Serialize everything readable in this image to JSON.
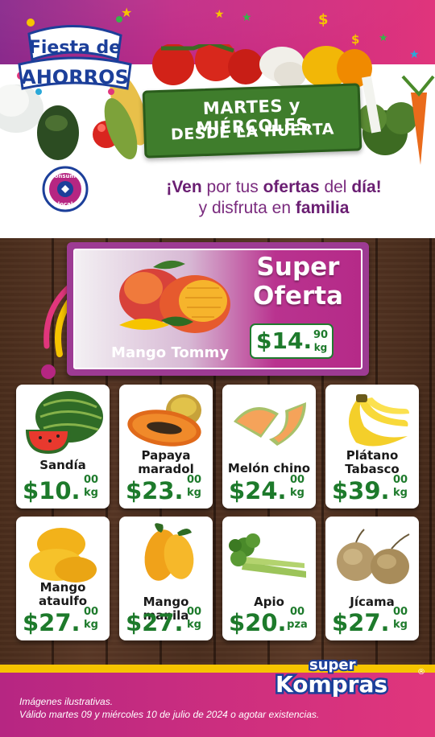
{
  "header": {
    "logo_line1": "Fiesta de",
    "logo_line2": "AHORROS",
    "banner_line1": "MARTES y MIÉRCOLES",
    "banner_line2": "DESDE LA HUERTA",
    "consume_local_line1": "consume",
    "consume_local_line2": "local",
    "tagline": {
      "l1_a": "¡Ven",
      "l1_b": " por tus ",
      "l1_c": "ofertas",
      "l1_d": " del ",
      "l1_e": "día!",
      "l2_a": "y disfruta en ",
      "l2_b": "familia"
    }
  },
  "feature": {
    "badge_line1": "Super",
    "badge_line2": "Oferta",
    "name": "Mango Tommy",
    "price_main": "$14.",
    "price_cents": "90",
    "unit": "kg"
  },
  "products": [
    {
      "name": "Sandía",
      "price_main": "$10.",
      "cents": "00",
      "unit": "kg",
      "icon": "watermelon-icon"
    },
    {
      "name": "Papaya maradol",
      "price_main": "$23.",
      "cents": "00",
      "unit": "kg",
      "icon": "papaya-icon"
    },
    {
      "name": "Melón chino",
      "price_main": "$24.",
      "cents": "00",
      "unit": "kg",
      "icon": "melon-icon"
    },
    {
      "name": "Plátano Tabasco",
      "price_main": "$39.",
      "cents": "00",
      "unit": "kg",
      "icon": "banana-icon"
    },
    {
      "name": "Mango ataulfo",
      "price_main": "$27.",
      "cents": "00",
      "unit": "kg",
      "icon": "mango-ataulfo-icon"
    },
    {
      "name": "Mango manila",
      "price_main": "$27.",
      "cents": "00",
      "unit": "kg",
      "icon": "mango-manila-icon"
    },
    {
      "name": "Apio",
      "price_main": "$20.",
      "cents": "00",
      "unit": "pza",
      "icon": "celery-icon"
    },
    {
      "name": "Jícama",
      "price_main": "$27.",
      "cents": "00",
      "unit": "kg",
      "icon": "jicama-icon"
    }
  ],
  "footer": {
    "line1": "Imágenes ilustrativas.",
    "line2": "Válido martes 09 y miércoles 10 de julio de 2024 o agotar existencias.",
    "brand_line1": "super",
    "brand_line2": "Kompras",
    "brand_mark": "®"
  },
  "colors": {
    "magenta": "#b62682",
    "purple": "#8a2a8c",
    "price_green": "#1d7a2b",
    "banner_green": "#3f7d2c",
    "footer_yellow": "#f6c400",
    "brand_blue": "#1c3f9a"
  }
}
